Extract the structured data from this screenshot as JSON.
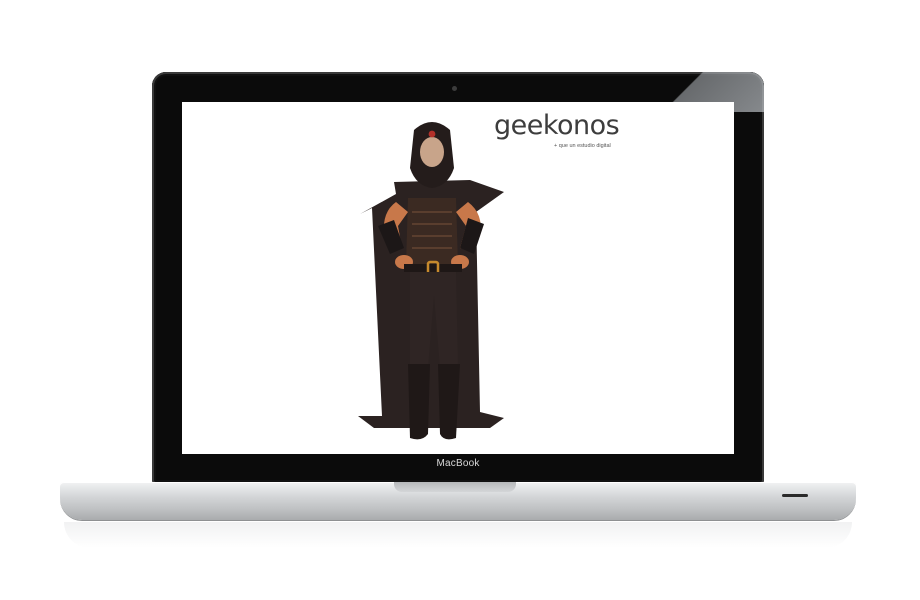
{
  "device": {
    "label": "MacBook"
  },
  "screen": {
    "brand": {
      "name": "geekonos",
      "tagline": "+ que un estudio digital"
    },
    "hero_image": {
      "subject": "3d-character-hooded-warrior"
    }
  },
  "colors": {
    "lid": "#0b0b0b",
    "screen_bg": "#ffffff",
    "logo_text": "#3d3d3d",
    "cloak": "#2b2221",
    "skin": "#c8784a",
    "accent_gold": "#c78a2d"
  }
}
